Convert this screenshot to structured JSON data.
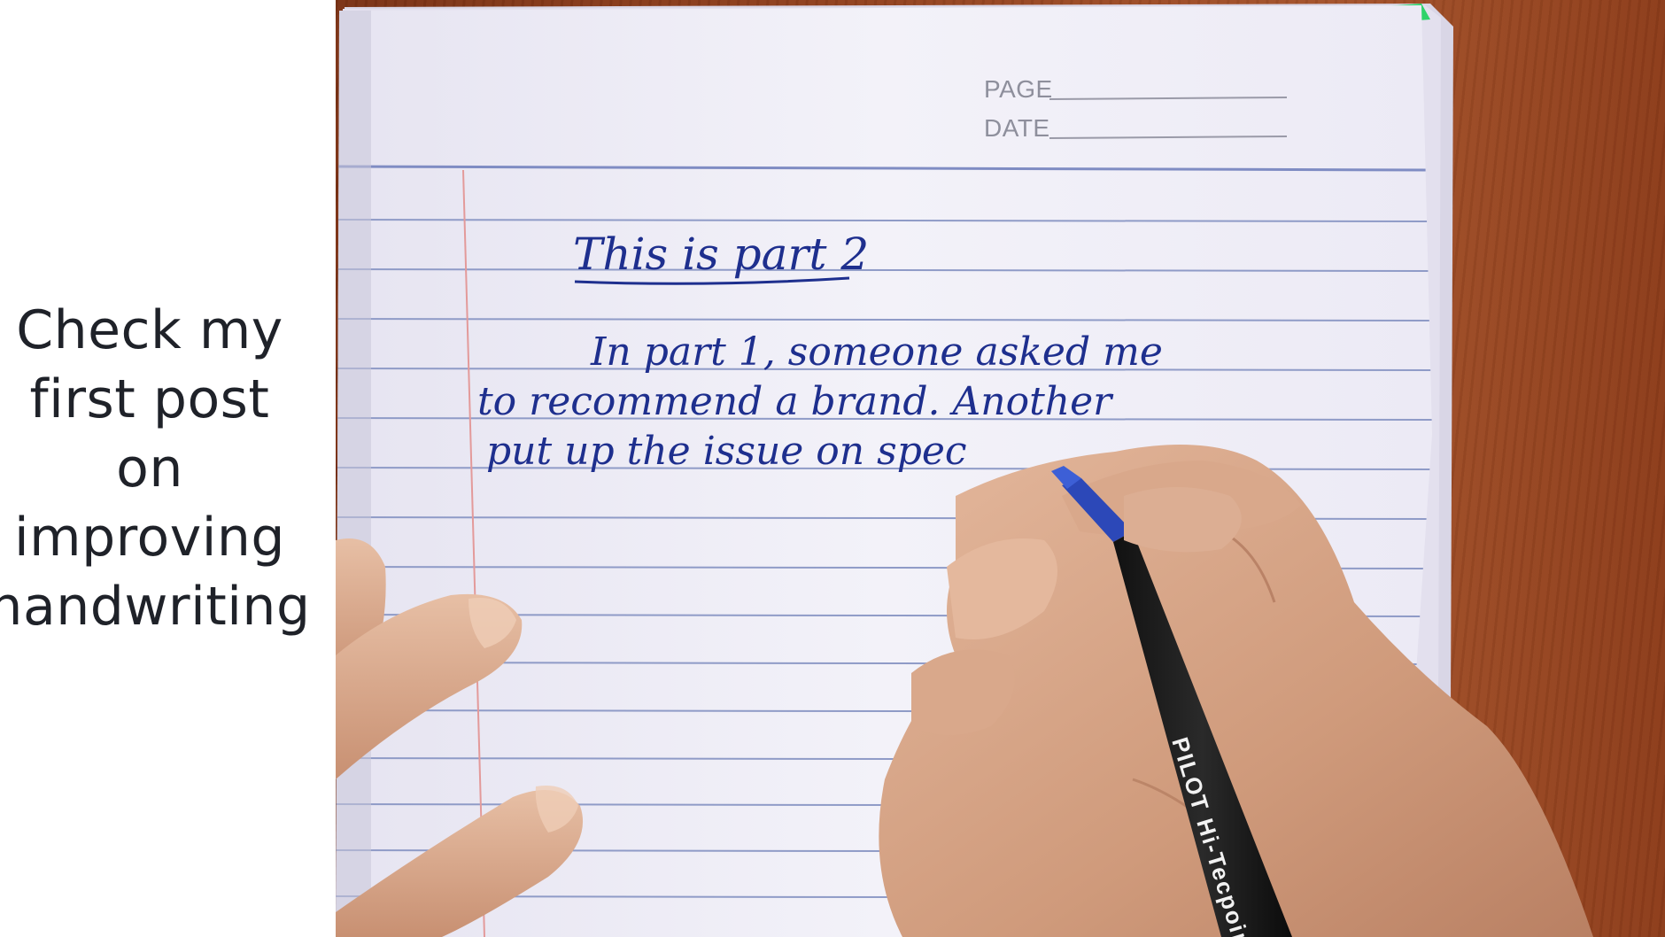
{
  "caption": {
    "lines": [
      "Check my",
      "first post",
      "on",
      "improving",
      "handwriting"
    ]
  },
  "notebook": {
    "page_label": "PAGE",
    "date_label": "DATE"
  },
  "handwriting": {
    "title": "This is part 2",
    "line1": "In part 1, someone asked me",
    "line2": "to recommend a brand. Another",
    "line3": "put up the issue on spec"
  },
  "pen": {
    "brand": "PILOT Hi-Tecpoint"
  },
  "colors": {
    "ink": "#1e2f8e",
    "rule_line": "#8f9bc7",
    "margin_line": "#e39a9a",
    "paper": "#f1f0f8",
    "desk": "#93421f",
    "tab_green": "#2fd36a",
    "caption_text": "#1f2229"
  }
}
